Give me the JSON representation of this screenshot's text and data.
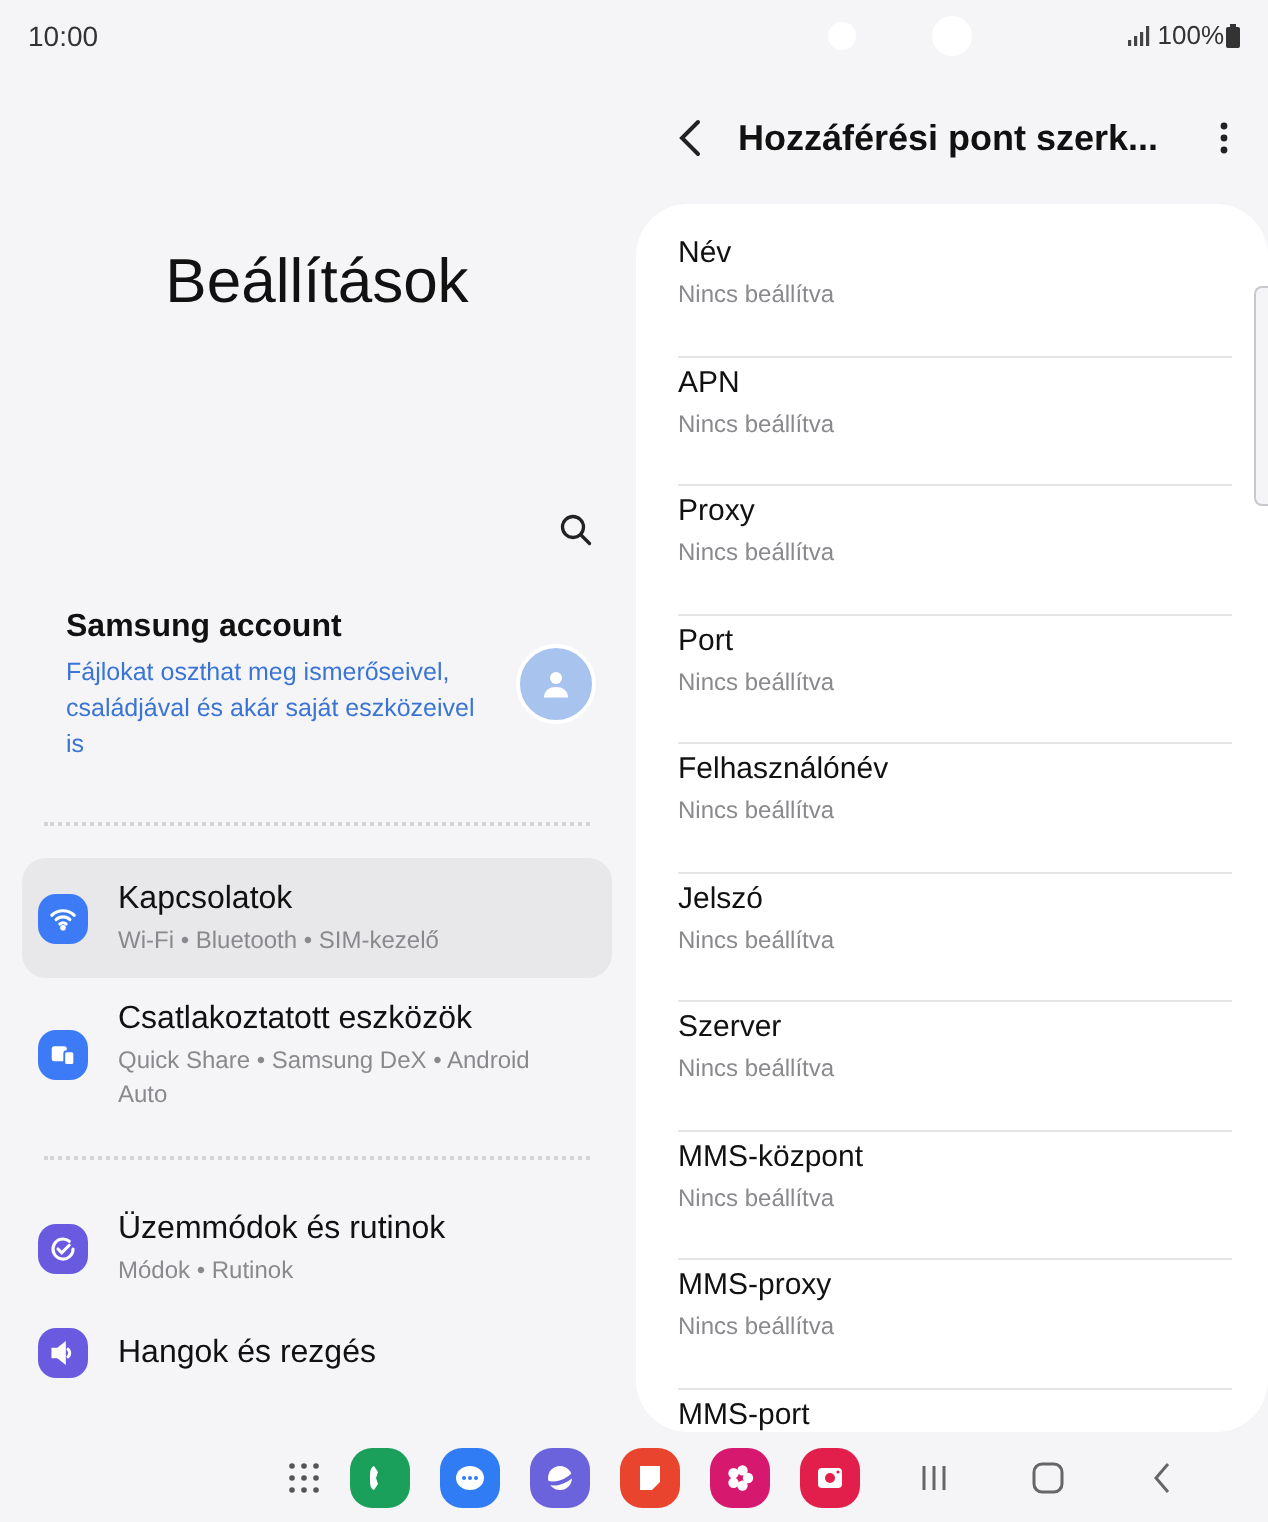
{
  "status_bar": {
    "time": "10:00",
    "battery": "100%"
  },
  "settings": {
    "title": "Beállítások",
    "account": {
      "name": "Samsung account",
      "description": "Fájlokat oszthat meg ismerőseivel, családjával és akár saját eszközeivel is"
    },
    "groups": [
      [
        {
          "kind": "wifi",
          "title": "Kapcsolatok",
          "subtitle": "Wi-Fi • Bluetooth • SIM-kezelő",
          "selected": true
        },
        {
          "kind": "devices",
          "title": "Csatlakoztatott eszközök",
          "subtitle": "Quick Share • Samsung DeX • Android Auto",
          "selected": false
        }
      ],
      [
        {
          "kind": "modes",
          "title": "Üzemmódok és rutinok",
          "subtitle": "Módok • Rutinok",
          "selected": false
        },
        {
          "kind": "sound",
          "title": "Hangok és rezgés",
          "selected": false
        }
      ]
    ]
  },
  "detail": {
    "title": "Hozzáférési pont szerk...",
    "fields": [
      {
        "label": "Név",
        "value": "Nincs beállítva"
      },
      {
        "label": "APN",
        "value": "Nincs beállítva"
      },
      {
        "label": "Proxy",
        "value": "Nincs beállítva"
      },
      {
        "label": "Port",
        "value": "Nincs beállítva"
      },
      {
        "label": "Felhasználónév",
        "value": "Nincs beállítva"
      },
      {
        "label": "Jelszó",
        "value": "Nincs beállítva"
      },
      {
        "label": "Szerver",
        "value": "Nincs beállítva"
      },
      {
        "label": "MMS-központ",
        "value": "Nincs beállítva"
      },
      {
        "label": "MMS-proxy",
        "value": "Nincs beállítva"
      },
      {
        "label": "MMS-port"
      }
    ]
  }
}
